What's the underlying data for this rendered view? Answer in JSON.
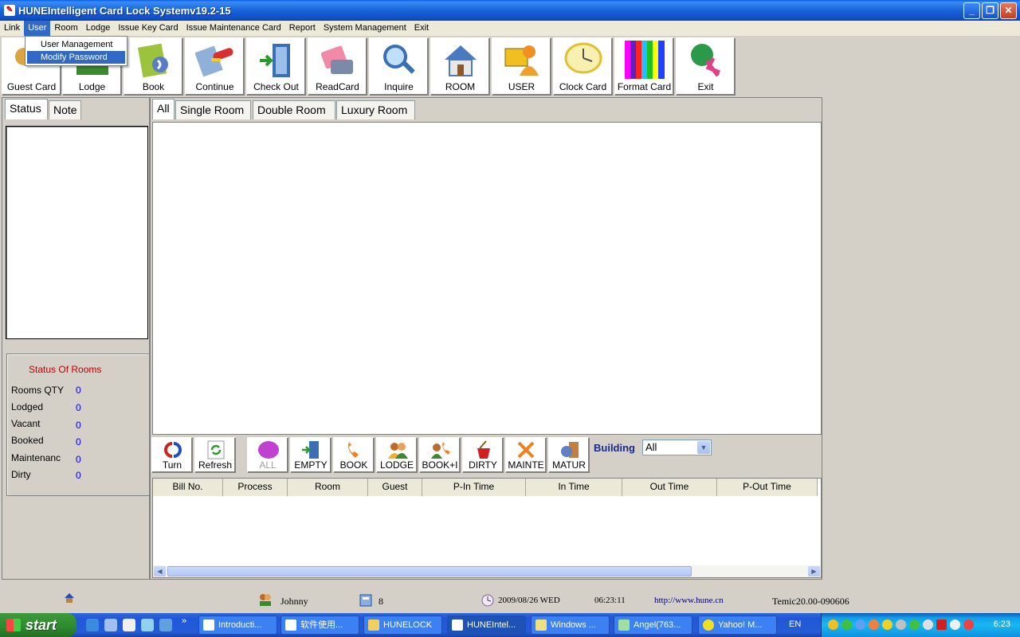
{
  "window": {
    "title": "HUNEIntelligent Card Lock Systemv19.2-15"
  },
  "menu": [
    "Link",
    "User",
    "Room",
    "Lodge",
    "Issue Key Card",
    "Issue Maintenance Card",
    "Report",
    "System Management",
    "Exit"
  ],
  "user_menu": [
    "User Management",
    "Modify Password"
  ],
  "toolbar": [
    {
      "label": "Guest Card",
      "icon": "key-icon"
    },
    {
      "label": "Lodge",
      "icon": "lodge-icon"
    },
    {
      "label": "Book",
      "icon": "book-icon"
    },
    {
      "label": "Continue",
      "icon": "continue-icon"
    },
    {
      "label": "Check Out",
      "icon": "check-out-icon"
    },
    {
      "label": "ReadCard",
      "icon": "read-card-icon"
    },
    {
      "label": "Inquire",
      "icon": "inquire-icon"
    },
    {
      "label": "ROOM",
      "icon": "house-icon"
    },
    {
      "label": "USER",
      "icon": "user-icon"
    },
    {
      "label": "Clock Card",
      "icon": "clock-icon"
    },
    {
      "label": "Format Card",
      "icon": "color-bars-icon"
    },
    {
      "label": "Exit",
      "icon": "exit-icon"
    }
  ],
  "left_tabs": [
    "Status",
    "Note"
  ],
  "room_status": {
    "title": "Status Of Rooms",
    "rows": [
      {
        "label": "Rooms QTY",
        "value": "0"
      },
      {
        "label": "Lodged",
        "value": "0"
      },
      {
        "label": "Vacant",
        "value": "0"
      },
      {
        "label": "Booked",
        "value": "0"
      },
      {
        "label": "Maintenanc",
        "value": "0"
      },
      {
        "label": "Dirty",
        "value": "0"
      }
    ]
  },
  "room_tabs": [
    "All",
    "Single Room",
    "Double Room",
    "Luxury Room"
  ],
  "filter_buttons": [
    {
      "label": "Turn",
      "icon": "turn-icon"
    },
    {
      "label": "Refresh",
      "icon": "refresh-icon"
    },
    {
      "label": "ALL",
      "icon": "circle-icon"
    },
    {
      "label": "EMPTY",
      "icon": "empty-door-icon"
    },
    {
      "label": "BOOK",
      "icon": "phone-icon"
    },
    {
      "label": "LODGE",
      "icon": "people-icon"
    },
    {
      "label": "BOOK+I",
      "icon": "book-lodge-icon"
    },
    {
      "label": "DIRTY",
      "icon": "bucket-icon"
    },
    {
      "label": "MAINTE",
      "icon": "tools-icon"
    },
    {
      "label": "MATUR",
      "icon": "matur-icon"
    }
  ],
  "building": {
    "label": "Building",
    "value": "All"
  },
  "grid_columns": [
    "Bill No.",
    "Process",
    "Room",
    "Guest",
    "P-In Time",
    "In Time",
    "Out Time",
    "P-Out Time"
  ],
  "statusbar": {
    "user": "Johnny",
    "count": "8",
    "date": "2009/08/26  WED",
    "time": "06:23:11",
    "url": "http://www.hune.cn",
    "version": "Temic20.00-090606"
  },
  "taskbar": {
    "start": "start",
    "tasks": [
      "Introducti...",
      "软件使用...",
      "HUNELOCK",
      "HUNEIntel...",
      "Windows ...",
      "Angel(763...",
      "Yahoo! M..."
    ],
    "lang": "EN",
    "clock": "6:23"
  }
}
